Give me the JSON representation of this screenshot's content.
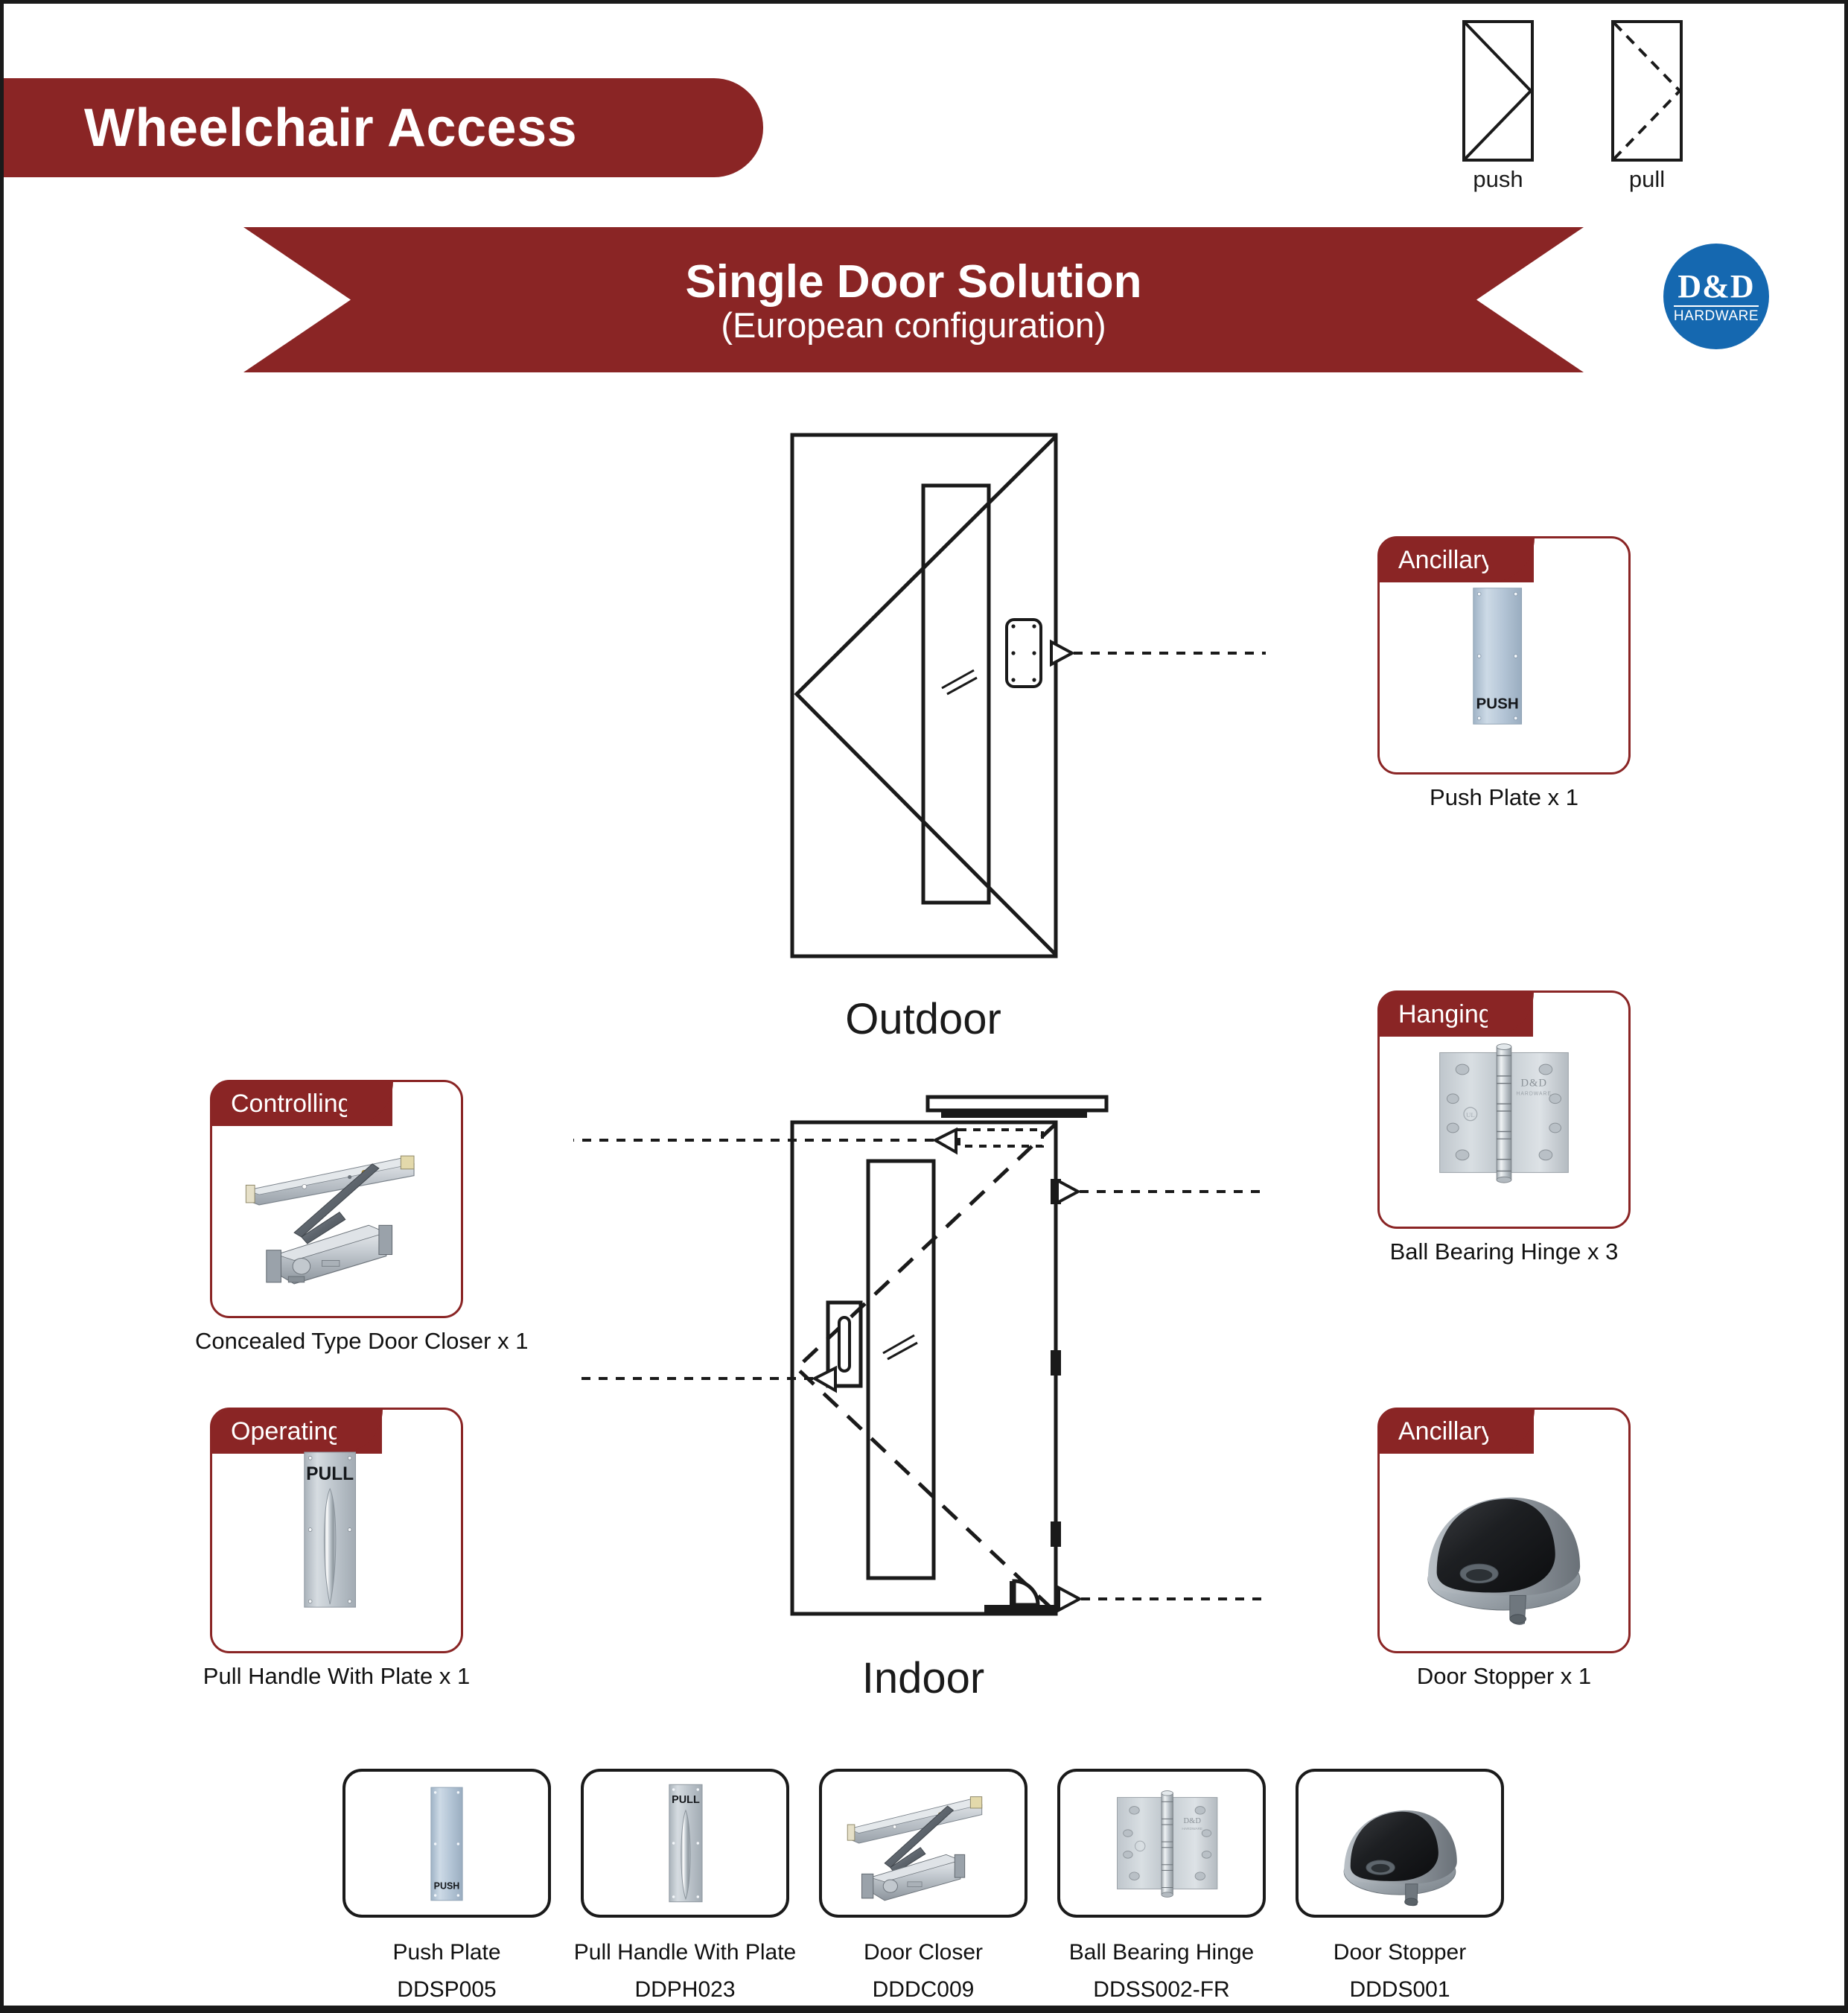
{
  "header": {
    "pill_label": "Wheelchair Access",
    "banner_title": "Single Door Solution",
    "banner_subtitle": "(European configuration)",
    "logo_main": "D&D",
    "logo_sub": "HARDWARE"
  },
  "legend": {
    "push_label": "push",
    "pull_label": "pull"
  },
  "diagram": {
    "outdoor_label": "Outdoor",
    "indoor_label": "Indoor"
  },
  "colors": {
    "brand_red": "#8a2525",
    "logo_blue": "#1568b0",
    "line_black": "#1a1a1a",
    "plate_metal": "#aebfd0"
  },
  "callouts": [
    {
      "id": "push-plate",
      "tag": "Ancillary",
      "caption": "Push Plate x 1",
      "plate_text": "PUSH"
    },
    {
      "id": "door-closer",
      "tag": "Controlling",
      "caption": "Concealed Type Door Closer x 1"
    },
    {
      "id": "pull-handle",
      "tag": "Operating",
      "caption": "Pull Handle With Plate x 1",
      "plate_text": "PULL"
    },
    {
      "id": "ball-bearing-hinge",
      "tag": "Hanging",
      "caption": "Ball Bearing Hinge x 3",
      "hinge_brand": "D&D",
      "hinge_brand_sub": "HARDWARE"
    },
    {
      "id": "door-stopper",
      "tag": "Ancillary",
      "caption": "Door Stopper x 1"
    }
  ],
  "products": [
    {
      "name": "Push Plate",
      "code": "DDSP005",
      "plate_text": "PUSH"
    },
    {
      "name": "Pull Handle With Plate",
      "code": "DDPH023",
      "plate_text": "PULL"
    },
    {
      "name": "Door Closer",
      "code": "DDDC009"
    },
    {
      "name": "Ball Bearing Hinge",
      "code": "DDSS002-FR",
      "hinge_brand": "D&D",
      "hinge_brand_sub": "HARDWARE"
    },
    {
      "name": "Door Stopper",
      "code": "DDDS001"
    }
  ]
}
